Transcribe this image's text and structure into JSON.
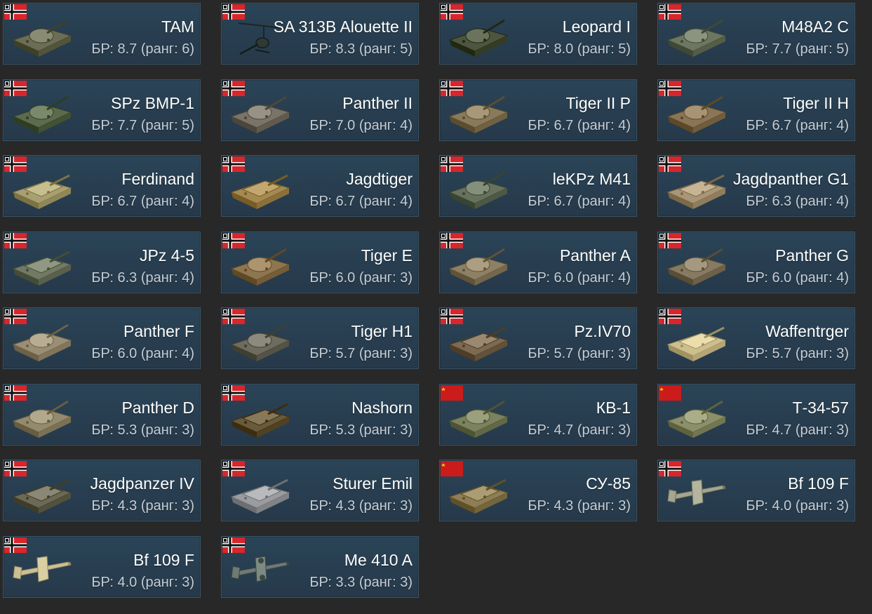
{
  "colors": {
    "background": "#282828",
    "card": "#2a4457",
    "card_border": "#3b5466",
    "name_text": "#ffffff",
    "br_text": "#c6ced6"
  },
  "vehicles": [
    {
      "name": "TAM",
      "br": "БР: 8.7 (ранг: 6)",
      "nation": "germany",
      "flag_icon": "german-war-flag-icon",
      "thumb_icon": "tank-icon",
      "camo": "#6b6e55"
    },
    {
      "name": "SA 313B Alouette II",
      "br": "БР: 8.3 (ранг: 5)",
      "nation": "germany",
      "flag_icon": "german-war-flag-icon",
      "thumb_icon": "helicopter-icon",
      "camo": "#2e3a36"
    },
    {
      "name": "Leopard I",
      "br": "БР: 8.0 (ранг: 5)",
      "nation": "germany",
      "flag_icon": "german-war-flag-icon",
      "thumb_icon": "tank-icon",
      "camo": "#4e553e"
    },
    {
      "name": "M48A2 C",
      "br": "БР: 7.7 (ранг: 5)",
      "nation": "germany",
      "flag_icon": "german-war-flag-icon",
      "thumb_icon": "tank-icon",
      "camo": "#6c7660"
    },
    {
      "name": "SPz BMP-1",
      "br": "БР: 7.7 (ранг: 5)",
      "nation": "germany",
      "flag_icon": "german-war-flag-icon",
      "thumb_icon": "tank-icon",
      "camo": "#5c6a4e"
    },
    {
      "name": "Panther II",
      "br": "БР: 7.0 (ранг: 4)",
      "nation": "germany",
      "flag_icon": "german-war-flag-icon",
      "thumb_icon": "tank-icon",
      "camo": "#7a7468"
    },
    {
      "name": "Tiger II P",
      "br": "БР: 6.7 (ранг: 4)",
      "nation": "germany",
      "flag_icon": "german-war-flag-icon",
      "thumb_icon": "tank-icon",
      "camo": "#8a7a5c"
    },
    {
      "name": "Tiger II H",
      "br": "БР: 6.7 (ранг: 4)",
      "nation": "germany",
      "flag_icon": "german-war-flag-icon",
      "thumb_icon": "tank-icon",
      "camo": "#8a7656"
    },
    {
      "name": "Ferdinand",
      "br": "БР: 6.7 (ранг: 4)",
      "nation": "germany",
      "flag_icon": "german-war-flag-icon",
      "thumb_icon": "tank-destroyer-icon",
      "camo": "#a8a070"
    },
    {
      "name": "Jagdtiger",
      "br": "БР: 6.7 (ранг: 4)",
      "nation": "germany",
      "flag_icon": "german-war-flag-icon",
      "thumb_icon": "tank-destroyer-icon",
      "camo": "#a48a52"
    },
    {
      "name": "leKPz M41",
      "br": "БР: 6.7 (ранг: 4)",
      "nation": "germany",
      "flag_icon": "german-war-flag-icon",
      "thumb_icon": "tank-icon",
      "camo": "#66715e"
    },
    {
      "name": "Jagdpanther G1",
      "br": "БР: 6.3 (ранг: 4)",
      "nation": "germany",
      "flag_icon": "german-war-flag-icon",
      "thumb_icon": "tank-destroyer-icon",
      "camo": "#a89676"
    },
    {
      "name": "JPz 4-5",
      "br": "БР: 6.3 (ранг: 4)",
      "nation": "germany",
      "flag_icon": "german-war-flag-icon",
      "thumb_icon": "tank-destroyer-icon",
      "camo": "#727a66"
    },
    {
      "name": "Tiger E",
      "br": "БР: 6.0 (ранг: 3)",
      "nation": "germany",
      "flag_icon": "german-war-flag-icon",
      "thumb_icon": "tank-icon",
      "camo": "#8e7650"
    },
    {
      "name": "Panther A",
      "br": "БР: 6.0 (ранг: 4)",
      "nation": "germany",
      "flag_icon": "german-war-flag-icon",
      "thumb_icon": "tank-icon",
      "camo": "#8e8064"
    },
    {
      "name": "Panther G",
      "br": "БР: 6.0 (ранг: 4)",
      "nation": "germany",
      "flag_icon": "german-war-flag-icon",
      "thumb_icon": "tank-icon",
      "camo": "#867a62"
    },
    {
      "name": "Panther F",
      "br": "БР: 6.0 (ранг: 4)",
      "nation": "germany",
      "flag_icon": "german-war-flag-icon",
      "thumb_icon": "tank-icon",
      "camo": "#9a8e74"
    },
    {
      "name": "Tiger H1",
      "br": "БР: 5.7 (ранг: 3)",
      "nation": "germany",
      "flag_icon": "german-war-flag-icon",
      "thumb_icon": "tank-icon",
      "camo": "#6e6c5e"
    },
    {
      "name": "Pz.IV70",
      "br": "БР: 5.7 (ранг: 3)",
      "nation": "germany",
      "flag_icon": "german-war-flag-icon",
      "thumb_icon": "tank-destroyer-icon",
      "camo": "#7c6a52"
    },
    {
      "name": "Waffentrger",
      "br": "БР: 5.7 (ранг: 3)",
      "nation": "germany",
      "flag_icon": "german-war-flag-icon",
      "thumb_icon": "tank-destroyer-icon",
      "camo": "#cdbf8e"
    },
    {
      "name": "Panther D",
      "br": "БР: 5.3 (ранг: 3)",
      "nation": "germany",
      "flag_icon": "german-war-flag-icon",
      "thumb_icon": "tank-icon",
      "camo": "#948a6e"
    },
    {
      "name": "Nashorn",
      "br": "БР: 5.3 (ранг: 3)",
      "nation": "germany",
      "flag_icon": "german-war-flag-icon",
      "thumb_icon": "tank-destroyer-icon",
      "camo": "#6a5a3c"
    },
    {
      "name": "КВ-1",
      "br": "БР: 4.7 (ранг: 3)",
      "nation": "ussr",
      "flag_icon": "soviet-flag-icon",
      "thumb_icon": "tank-icon",
      "camo": "#7c8260"
    },
    {
      "name": "Т-34-57",
      "br": "БР: 4.7 (ранг: 3)",
      "nation": "ussr",
      "flag_icon": "soviet-flag-icon",
      "thumb_icon": "tank-icon",
      "camo": "#8c906a"
    },
    {
      "name": "Jagdpanzer IV",
      "br": "БР: 4.3 (ранг: 3)",
      "nation": "germany",
      "flag_icon": "german-war-flag-icon",
      "thumb_icon": "tank-destroyer-icon",
      "camo": "#6c6a56"
    },
    {
      "name": "Sturer Emil",
      "br": "БР: 4.3 (ранг: 3)",
      "nation": "germany",
      "flag_icon": "german-war-flag-icon",
      "thumb_icon": "tank-destroyer-icon",
      "camo": "#9a9ca0"
    },
    {
      "name": "СУ-85",
      "br": "БР: 4.3 (ранг: 3)",
      "nation": "ussr",
      "flag_icon": "soviet-flag-icon",
      "thumb_icon": "tank-destroyer-icon",
      "camo": "#8e7e56"
    },
    {
      "name": "Bf 109 F",
      "br": "БР: 4.0 (ранг: 3)",
      "nation": "germany",
      "flag_icon": "german-war-flag-icon",
      "thumb_icon": "fighter-plane-icon",
      "camo": "#a4a690"
    },
    {
      "name": "Bf 109 F",
      "br": "БР: 4.0 (ранг: 3)",
      "nation": "germany",
      "flag_icon": "german-war-flag-icon",
      "thumb_icon": "fighter-plane-icon",
      "camo": "#cbbf94"
    },
    {
      "name": "Me 410 A",
      "br": "БР: 3.3 (ранг: 3)",
      "nation": "germany",
      "flag_icon": "german-war-flag-icon",
      "thumb_icon": "bomber-plane-icon",
      "camo": "#6e7a74"
    }
  ]
}
